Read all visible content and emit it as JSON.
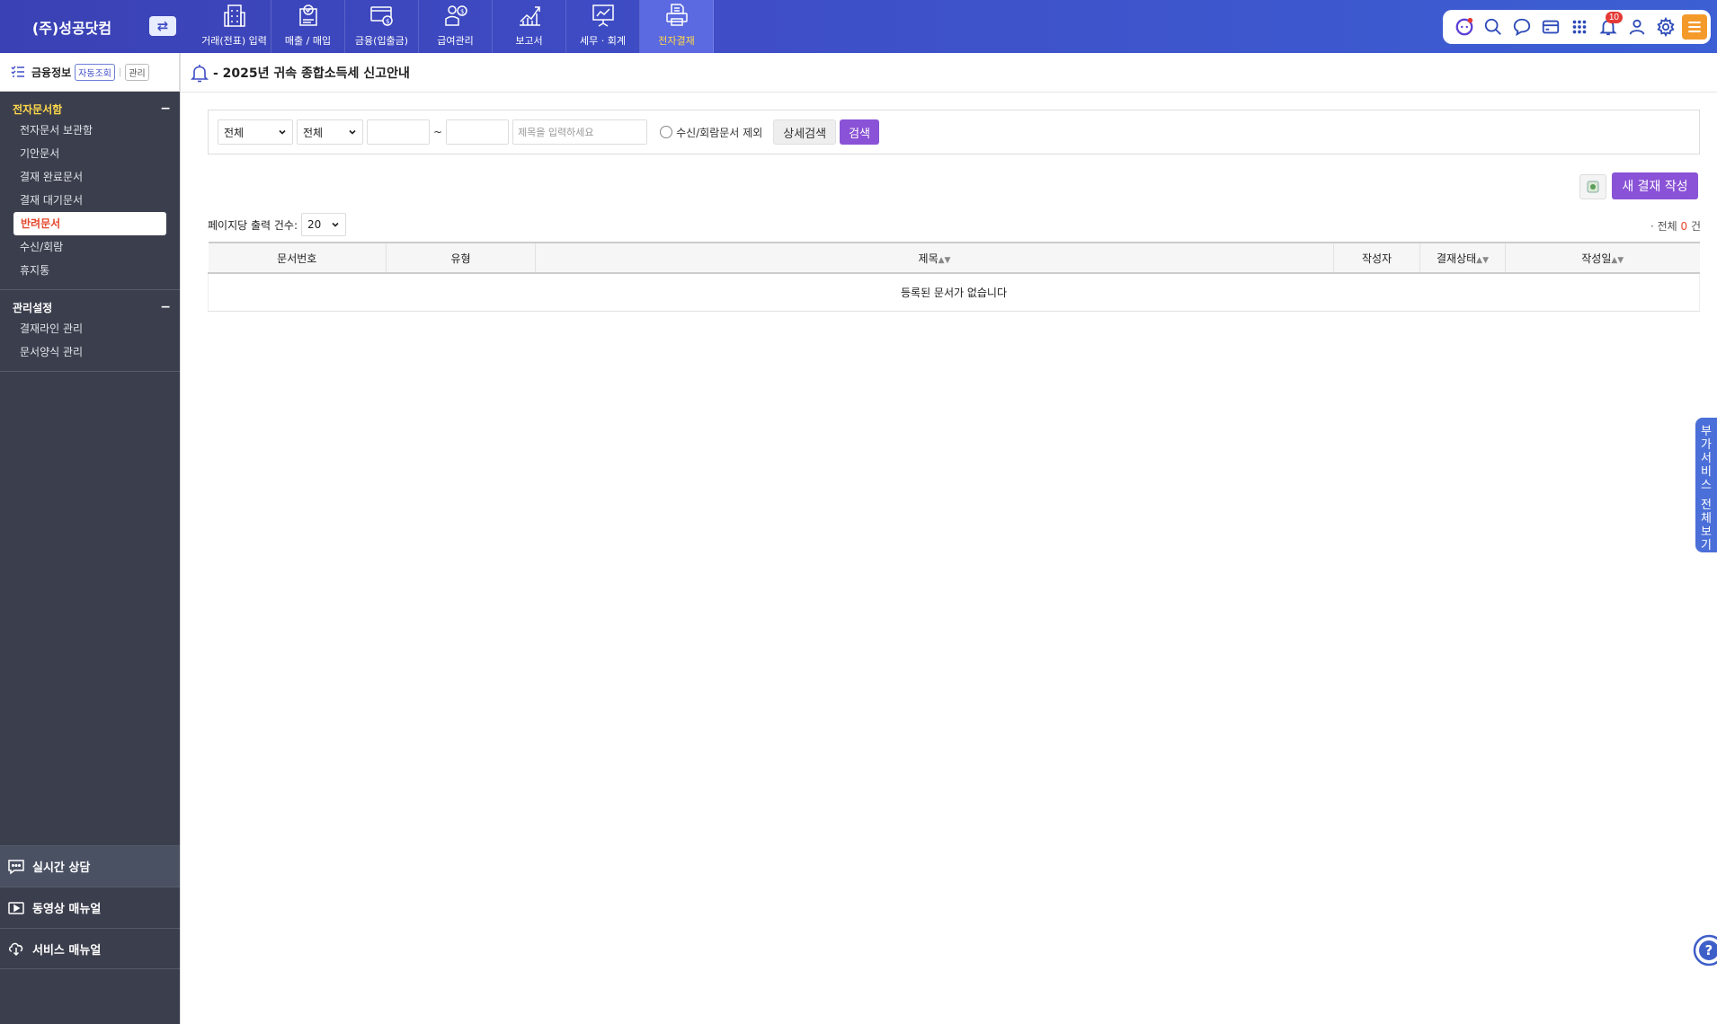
{
  "topbar": {
    "company": "(주)성공닷컴",
    "switch_symbol": "⇄",
    "nav": [
      {
        "label": "거래(전표) 입력"
      },
      {
        "label": "매출 / 매입"
      },
      {
        "label": "금융(입출금)"
      },
      {
        "label": "급여관리"
      },
      {
        "label": "보고서"
      },
      {
        "label": "세무 · 회계"
      },
      {
        "label": "전자결재"
      }
    ],
    "notification_count": "10"
  },
  "sidebar": {
    "finance_title": "금융정보",
    "auto_query_label": "자동조회",
    "separator": "|",
    "manage_label": "관리",
    "sections": [
      {
        "title": "전자문서함",
        "collapse": "−",
        "items": [
          "전자문서 보관함",
          "기안문서",
          "결재 완료문서",
          "결재 대기문서",
          "반려문서",
          "수신/회람",
          "휴지통"
        ]
      },
      {
        "title": "관리설정",
        "collapse": "−",
        "items": [
          "결재라인 관리",
          "문서양식 관리"
        ]
      }
    ],
    "bottom_links": [
      "실시간 상담",
      "동영상 매뉴얼",
      "서비스 매뉴얼"
    ]
  },
  "main": {
    "notice": "- 2025년 귀속 종합소득세 신고안내",
    "search": {
      "select1": "전체",
      "select2": "전체",
      "tilde": "~",
      "title_placeholder": "제목을 입력하세요",
      "exclude_label": "수신/회람문서 제외",
      "detail_search": "상세검색",
      "search_button": "검색"
    },
    "new_approval": "새 결재 작성",
    "per_page_label": "페이지당 출력 건수:",
    "per_page_value": "20",
    "total_prefix": "· 전체",
    "total_count": "0",
    "total_suffix": "건",
    "table": {
      "columns": [
        "문서번호",
        "유형",
        "제목",
        "작성자",
        "결재상태",
        "작성일"
      ],
      "sort_symbol": "▲▼",
      "empty_message": "등록된 문서가 없습니다"
    }
  },
  "side_tab": [
    "부",
    "가",
    "서",
    "비",
    "스",
    "",
    "전",
    "체",
    "보",
    "기"
  ],
  "colors": {
    "topbar": "#3f4dc6",
    "active_nav": "#5b6ae0",
    "active_text": "#ffd84a",
    "sidebar": "#3b3f4d",
    "accent_purple": "#8a52d6",
    "selected_red": "#e4472c",
    "section_yellow": "#ffd84a"
  },
  "icons": {
    "nav": [
      "building-icon",
      "receipt-check-icon",
      "money-card-icon",
      "payroll-person-icon",
      "chart-up-icon",
      "presentation-chart-icon",
      "printer-doc-icon"
    ],
    "util": [
      "chatbot-icon",
      "search-icon",
      "chat-bubble-icon",
      "card-icon",
      "apps-grid-icon",
      "bell-icon",
      "user-icon",
      "gear-icon",
      "hamburger-menu-icon"
    ]
  }
}
